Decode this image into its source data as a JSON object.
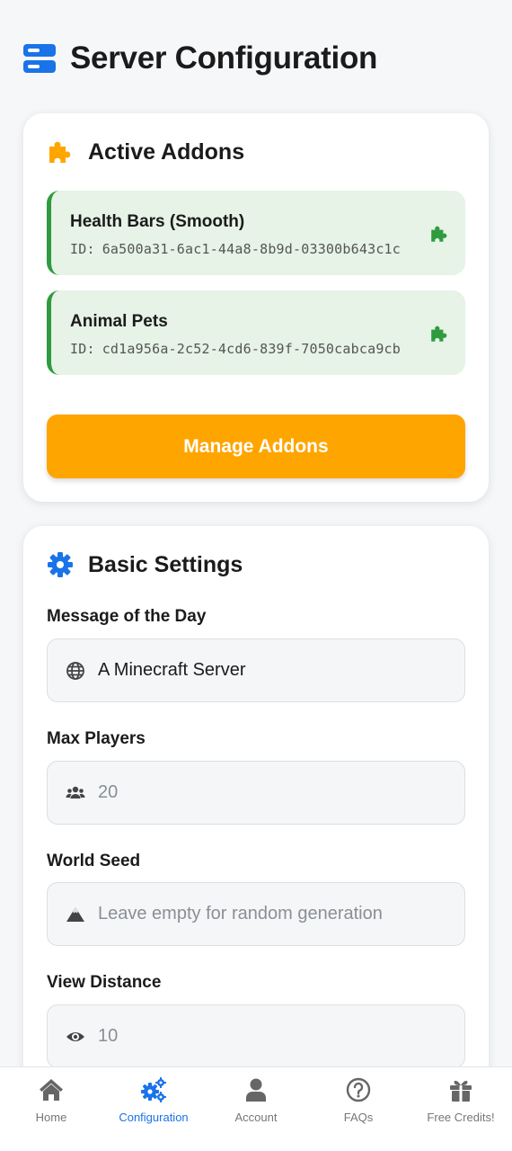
{
  "header": {
    "title": "Server Configuration",
    "icon": "server-icon",
    "icon_color": "#1a73e8"
  },
  "addons_card": {
    "title": "Active Addons",
    "icon": "puzzle-icon",
    "icon_color": "#ffa500",
    "id_label": "ID:",
    "items": [
      {
        "name": "Health Bars (Smooth)",
        "id": "6a500a31-6ac1-44a8-8b9d-03300b643c1c"
      },
      {
        "name": "Animal Pets",
        "id": "cd1a956a-2c52-4cd6-839f-7050cabca9cb"
      }
    ],
    "manage_label": "Manage Addons"
  },
  "basic_card": {
    "title": "Basic Settings",
    "icon": "gear-icon",
    "fields": {
      "motd": {
        "label": "Message of the Day",
        "value": "A Minecraft Server",
        "placeholder": "",
        "icon": "globe-icon"
      },
      "max_players": {
        "label": "Max Players",
        "value": "",
        "placeholder": "20",
        "icon": "users-icon"
      },
      "world_seed": {
        "label": "World Seed",
        "value": "",
        "placeholder": "Leave empty for random generation",
        "icon": "mountain-icon"
      },
      "view_distance": {
        "label": "View Distance",
        "value": "",
        "placeholder": "10",
        "icon": "eye-icon"
      }
    }
  },
  "nav": {
    "items": [
      {
        "label": "Home",
        "icon": "home-icon"
      },
      {
        "label": "Configuration",
        "icon": "gears-icon",
        "active": true
      },
      {
        "label": "Account",
        "icon": "user-icon"
      },
      {
        "label": "FAQs",
        "icon": "question-icon"
      },
      {
        "label": "Free Credits!",
        "icon": "gift-icon"
      }
    ]
  },
  "colors": {
    "accent": "#1a73e8",
    "addon_bg": "#e6f3e6",
    "addon_border": "#2e9b3f",
    "manage_button": "#ffa500"
  }
}
